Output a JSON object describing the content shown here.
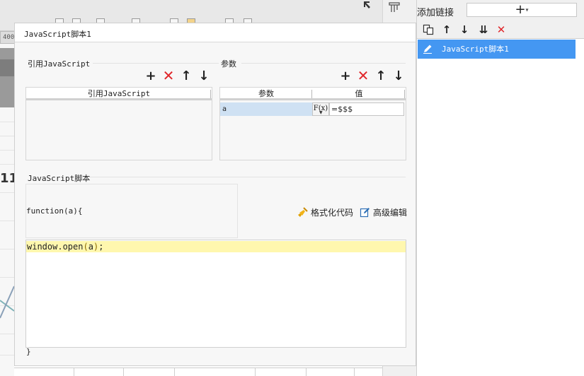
{
  "background": {
    "ruler_value": "400",
    "cell_number": "11"
  },
  "right_panel": {
    "title": "添加链接",
    "add_symbol": "+",
    "add_caret": "▾",
    "toolbar": {
      "copy": "copy-icon",
      "up": "↑",
      "down": "↓",
      "move_bottom": "⇊",
      "delete": "✕"
    },
    "items": [
      {
        "label": "JavaScript脚本1",
        "selected": true
      }
    ],
    "selected_color": "#4497f2"
  },
  "dialog": {
    "title": "JavaScript脚本1",
    "referenced_js": {
      "section_label": "引用JavaScript",
      "column_header": "引用JavaScript",
      "rows": []
    },
    "params": {
      "section_label": "参数",
      "headers": [
        "参数",
        "值"
      ],
      "rows": [
        {
          "name": "a",
          "formula_button": "F(x)",
          "value": "=$$$"
        }
      ]
    },
    "tools": {
      "add": "+",
      "delete": "✕",
      "up": "↑",
      "down": "↓"
    },
    "script": {
      "section_label": "JavaScript脚本",
      "signature": "function(a){",
      "format_code_label": "格式化代码",
      "advanced_edit_label": "高级编辑",
      "code_prefix": "window.open",
      "code_paren_open": "(",
      "code_arg": "a",
      "code_paren_close": ")",
      "code_suffix": ";",
      "closing": "}"
    },
    "delete_color": "#e0262a",
    "highlight_color": "#fff7ae"
  }
}
